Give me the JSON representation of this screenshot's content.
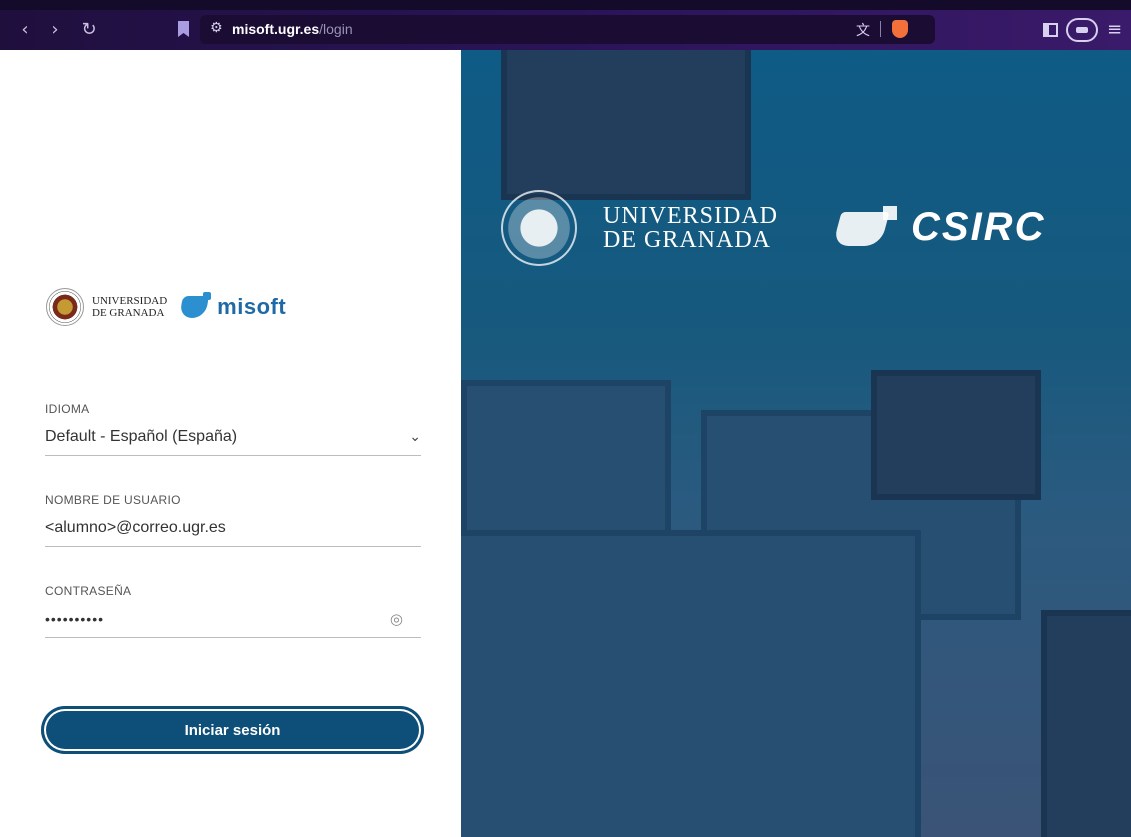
{
  "browser": {
    "url_host": "misoft.ugr.es",
    "url_path": "/login"
  },
  "brand": {
    "ugr_line1": "UNIVERSIDAD",
    "ugr_line2": "DE GRANADA",
    "app_name": "misoft"
  },
  "form": {
    "language_label": "IDIOMA",
    "language_value": "Default - Español (España)",
    "username_label": "NOMBRE DE USUARIO",
    "username_value": "<alumno>@correo.ugr.es",
    "password_label": "CONTRASEÑA",
    "password_value": "••••••••••",
    "submit_label": "Iniciar sesión"
  },
  "hero": {
    "ugr_line1": "UNIVERSIDAD",
    "ugr_line2": "DE GRANADA",
    "csirc_name": "CSIRC"
  },
  "icons": {
    "back": "back-icon",
    "forward": "forward-icon",
    "reload": "reload-icon",
    "bookmark": "bookmark-icon",
    "translate": "translate-icon",
    "brave": "brave-shield-icon",
    "sidebar": "sidebar-icon",
    "wallet": "wallet-icon",
    "menu": "menu-icon",
    "chevron": "chevron-down-icon",
    "eye": "eye-icon"
  },
  "colors": {
    "primary_button": "#0d4f78",
    "chrome_bg": "#2a1458",
    "hero_bg": "#17597e"
  }
}
